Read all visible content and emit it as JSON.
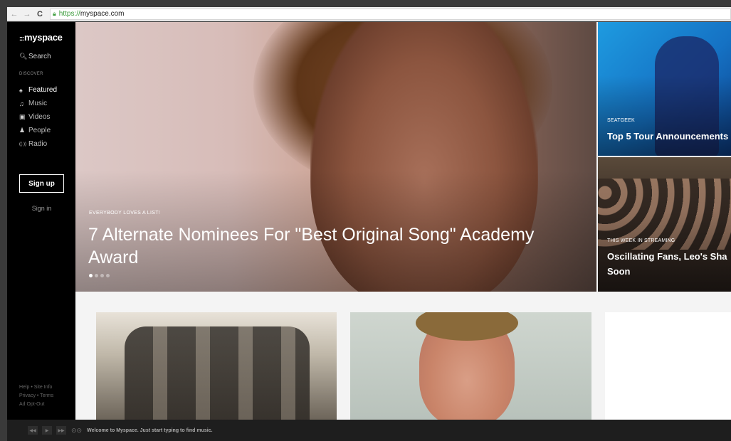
{
  "browser": {
    "url_scheme": "https://",
    "url_host": "myspace.com",
    "back_icon": "arrow-left-icon",
    "forward_icon": "arrow-right-icon",
    "reload_icon": "reload-icon",
    "lock_icon": "lock-icon"
  },
  "sidebar": {
    "logo": "myspace",
    "search_label": "Search",
    "section_label": "DISCOVER",
    "items": [
      {
        "label": "Featured",
        "icon": "flame-icon",
        "glyph": "♠",
        "active": true
      },
      {
        "label": "Music",
        "icon": "music-note-icon",
        "glyph": "♫",
        "active": false
      },
      {
        "label": "Videos",
        "icon": "video-icon",
        "glyph": "▣",
        "active": false
      },
      {
        "label": "People",
        "icon": "people-icon",
        "glyph": "♟",
        "active": false
      },
      {
        "label": "Radio",
        "icon": "radio-icon",
        "glyph": "((·))",
        "active": false
      }
    ],
    "signup_label": "Sign up",
    "signin_label": "Sign in",
    "footer": {
      "line1": "Help • Site Info",
      "line2": "Privacy • Terms",
      "line3": "Ad Opt-Out"
    }
  },
  "hero": {
    "kicker": "EVERYBODY LOVES A LIST!",
    "title": "7 Alternate Nominees For \"Best Original Song\" Academy Award",
    "slide_count": 4,
    "active_slide": 1
  },
  "side_cards": [
    {
      "kicker": "SEATGEEK",
      "title": "Top 5 Tour Announcements"
    },
    {
      "kicker": "THIS WEEK IN STREAMING",
      "title_line1": "Oscillating Fans, Leo's Sha",
      "title_line2": "Soon"
    }
  ],
  "player": {
    "message": "Welcome to Myspace. Just start typing to find music.",
    "buttons": [
      "rewind-icon",
      "play-icon",
      "fast-forward-icon",
      "connect-icon"
    ]
  }
}
